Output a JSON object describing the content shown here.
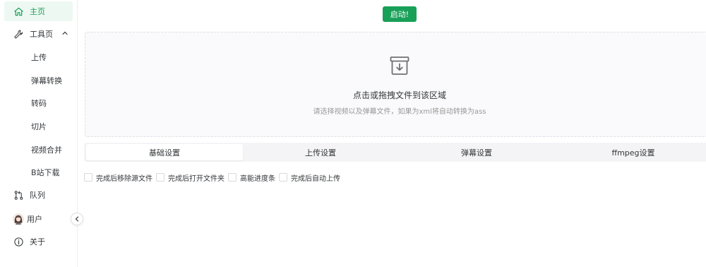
{
  "sidebar": {
    "home": {
      "label": "主页",
      "icon": "home-icon"
    },
    "tools": {
      "label": "工具页",
      "icon": "wrench-icon"
    },
    "tool_items": [
      "上传",
      "弹幕转换",
      "转码",
      "切片",
      "视频合并",
      "B站下载"
    ],
    "queue": {
      "label": "队列",
      "icon": "queue-icon"
    },
    "user": {
      "label": "用户",
      "icon": "user-avatar"
    },
    "about": {
      "label": "关于",
      "icon": "info-icon"
    }
  },
  "toolbar": {
    "start_label": "启动!"
  },
  "upload": {
    "title": "点击或拖拽文件到该区域",
    "hint": "请选择视频以及弹幕文件，如果为xml将自动转换为ass",
    "icon": "archive-download-icon"
  },
  "tabs": [
    "基础设置",
    "上传设置",
    "弹幕设置",
    "ffmpeg设置"
  ],
  "active_tab": 0,
  "options": [
    {
      "label": "完成后移除源文件",
      "checked": false
    },
    {
      "label": "完成后打开文件夹",
      "checked": false
    },
    {
      "label": "高能进度条",
      "checked": false
    },
    {
      "label": "完成后自动上传",
      "checked": false
    }
  ],
  "colors": {
    "accent": "#18a058",
    "active_bg": "#eef8f2"
  }
}
